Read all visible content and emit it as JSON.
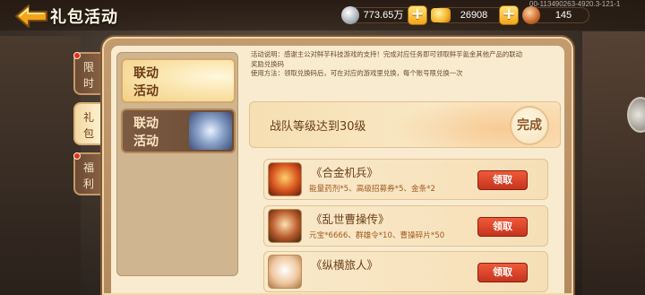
{
  "header": {
    "title": "礼包活动",
    "player_id": "00-113490263-4920.3-121-1",
    "resources": {
      "silver": "773.65万",
      "gold": "26908",
      "stamina": "145"
    }
  },
  "side_tabs": [
    {
      "line1": "限",
      "line2": "时"
    },
    {
      "line1": "礼",
      "line2": "包"
    },
    {
      "line1": "福",
      "line2": "利"
    }
  ],
  "categories": [
    {
      "line1": "联动",
      "line2": "活动"
    },
    {
      "line1": "联动",
      "line2": "活动"
    }
  ],
  "description": {
    "line1": "活动说明：感谢主公对鲜芋科技游戏的支持！完成对应任务即可领取鲜芋氪金其他产品的联动",
    "line2": "奖励兑换码",
    "line3": "使用方法：领取兑换码后，可在对应的游戏里兑换，每个账号限兑换一次"
  },
  "goal": {
    "text": "战队等级达到30级",
    "status": "完成"
  },
  "rewards": [
    {
      "name": "《合金机兵》",
      "items": "能量药剂*5、高级招募券*5、金条*2",
      "button": "领取"
    },
    {
      "name": "《乱世曹操传》",
      "items": "元宝*6666、群雄令*10、曹操碎片*50",
      "button": "领取"
    },
    {
      "name": "《纵横旅人》",
      "items": "",
      "button": "领取"
    }
  ],
  "colors": {
    "claim_button": "#d9432a",
    "accent_gold": "#f2a51a",
    "text_brown": "#6a3e18"
  }
}
